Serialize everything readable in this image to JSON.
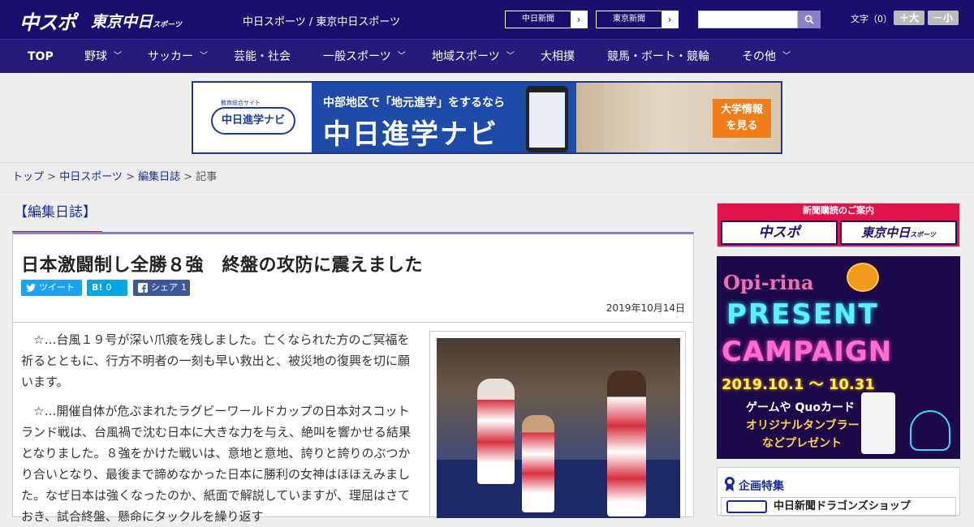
{
  "header": {
    "logo_main": "中スポ",
    "logo_tokyo": "東京中日",
    "logo_tokyo_sub": "スポーツ",
    "site_title": "中日スポーツ / 東京中日スポーツ",
    "link1": "中日新聞",
    "link2": "東京新聞",
    "search_placeholder": "",
    "font_size_label": "文字（0）",
    "font_bigger": "＋大",
    "font_smaller": "－小"
  },
  "nav": [
    {
      "label": "TOP",
      "has_menu": false
    },
    {
      "label": "野球",
      "has_menu": true
    },
    {
      "label": "サッカー",
      "has_menu": true
    },
    {
      "label": "芸能・社会",
      "has_menu": false
    },
    {
      "label": "一般スポーツ",
      "has_menu": true
    },
    {
      "label": "地域スポーツ",
      "has_menu": true
    },
    {
      "label": "大相撲",
      "has_menu": false
    },
    {
      "label": "競馬・ボート・競輪",
      "has_menu": false
    },
    {
      "label": "その他",
      "has_menu": true
    }
  ],
  "banner": {
    "logo_sub": "教育総合サイト",
    "logo": "中日進学ナビ",
    "line1": "中部地区で「地元進学」をするなら",
    "line2": "中日進学ナビ",
    "cta1": "大学情報",
    "cta2": "を見る"
  },
  "breadcrumb": {
    "top": "トップ",
    "site": "中日スポーツ",
    "section": "編集日誌",
    "current": "記事"
  },
  "category": "【編集日誌】",
  "article": {
    "title": "日本激闘制し全勝８強　終盤の攻防に震えました",
    "tweet": "ツイート",
    "hatena_label": "B!",
    "hatena_count": "0",
    "share_label": "シェア",
    "share_count": "1",
    "date": "2019年10月14日",
    "paragraphs": [
      "　☆…台風１９号が深い爪痕を残しました。亡くなられた方のご冥福を祈るとともに、行方不明者の一刻も早い救出と、被災地の復興を切に願います。",
      "　☆…開催自体が危ぶまれたラグビーワールドカップの日本対スコットランド戦は、台風禍で沈む日本に大きな力を与え、絶叫を響かせる結果となりました。８強をかけた戦いは、意地と意地、誇りと誇りのぶつかり合いとなり、最後まで諦めなかった日本に勝利の女神はほほえみました。なぜ日本は強くなったのか、紙面で解説していますが、理屈はさておき、試合終盤、懸命にタックルを繰り返す"
    ]
  },
  "sidebar": {
    "subscribe_title": "新聞購読のご案内",
    "sub_btn1": "中スポ",
    "sub_btn2": "東京中日",
    "sub_btn2_small": "スポーツ",
    "ad_brand": "Opi-rina",
    "ad_line1": "PRESENT",
    "ad_line2": "CAMPAIGN",
    "ad_date": "2019.10.1 ～ 10.31",
    "ad_text1": "ゲームや Quoカード",
    "ad_text2": "オリジナルタンブラー",
    "ad_text3": "などプレゼント",
    "feature_title": "企画特集",
    "feature_item": "中日新聞ドラゴンズショップ"
  },
  "colors": {
    "header_bg": "#1a0f6e",
    "nav_bg": "#241b7a",
    "accent_red": "#e2134b",
    "link_blue": "#1a2c9a",
    "twitter": "#1da1f2",
    "hatena": "#00a4de",
    "facebook": "#3b5998"
  }
}
